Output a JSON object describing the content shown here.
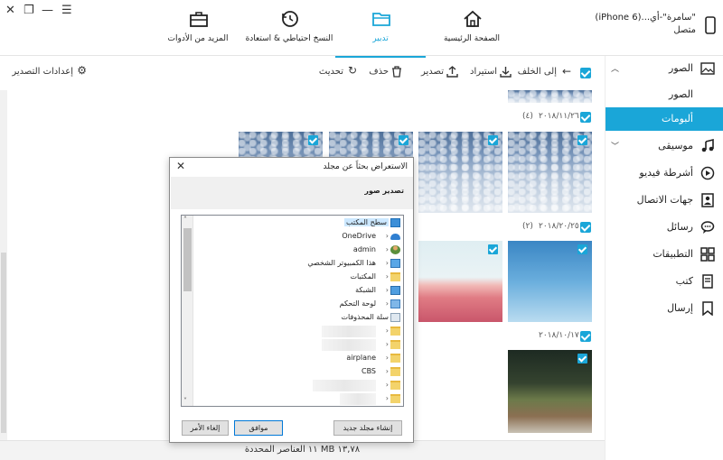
{
  "window": {
    "close_label": "✕",
    "restore_label": "❐",
    "minimize_label": "—",
    "menu_label": "☰"
  },
  "nav": {
    "home": "الصفحة الرئيسية",
    "manage": "تدبير",
    "backup": "النسخ احتياطي & استعادة",
    "tools": "المزيد من الأدوات"
  },
  "device": {
    "name": "\"سامرة\"-أي...(iPhone 6)",
    "status": "متصل"
  },
  "sidebar": {
    "photos": "الصور",
    "photos_sub": "الصور",
    "albums": "ألبومات",
    "music": "موسيقى",
    "videos": "أشرطة فيديو",
    "contacts": "جهات الاتصال",
    "messages": "رسائل",
    "apps": "التطبيقات",
    "books": "كتب",
    "send": "إرسال"
  },
  "toolbar": {
    "back": "إلى الخلف",
    "import": "استيراد",
    "export": "تصدير",
    "delete": "حذف",
    "refresh": "تحديث",
    "export_settings": "إعدادات التصدير"
  },
  "groups": [
    {
      "date": "٢٠١٨/١١/٢٦",
      "count": "(٤)"
    },
    {
      "date": "٢٠١٨/٢٠/٢٥",
      "count": "(٢)"
    },
    {
      "date": "٢٠١٨/١٠/١٧",
      "count": ""
    }
  ],
  "status_bar": {
    "text": "١١ العناصر المحددة MB ١٣,٧٨"
  },
  "dialog": {
    "title": "الاستعراض بحثاً عن مجلد",
    "subtitle": "تصدير صور",
    "tree": {
      "desktop": "سطح المكتب",
      "onedrive": "OneDrive",
      "admin": "admin",
      "this_pc": "هذا الكمبيوتر الشخصي",
      "libraries": "المكتبات",
      "network": "الشبكة",
      "control_panel": "لوحة التحكم",
      "recycle_bin": "سلة المحذوفات",
      "airplane": "airplane",
      "cbs": "CBS"
    },
    "new_folder": "إنشاء مجلد جديد",
    "ok": "موافق",
    "cancel": "إلغاء الأمر"
  },
  "colors": {
    "accent": "#1aa6d8"
  }
}
